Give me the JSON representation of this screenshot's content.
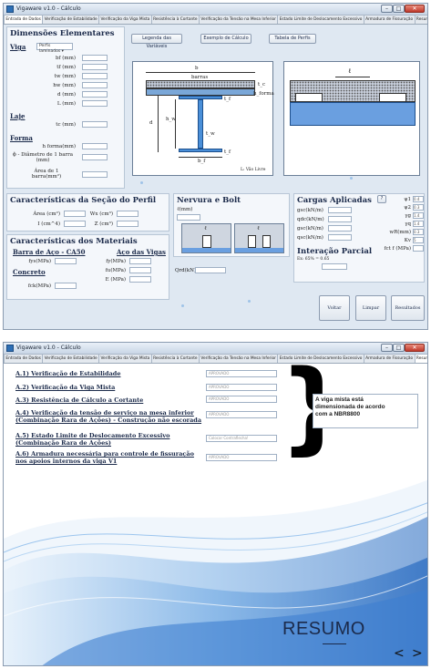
{
  "window": {
    "title": "Vigaware v1.0 - Cálculo",
    "minimize": "–",
    "maximize": "□",
    "close": "✕"
  },
  "tabs": [
    "Entrada de Dados",
    "Verificação de Estabilidade",
    "Verificação da Viga Mista",
    "Resistência à Cortante",
    "Verificação da Tensão na Mesa Inferior",
    "Estado Limite de Deslocamento Excessivo",
    "Armadura de Fissuração",
    "Resumo"
  ],
  "screen1": {
    "dim_title": "Dimensões Elementares",
    "viga_label": "Viga",
    "profile_select": "Perfis laminados",
    "viga_fields": [
      "bf (mm)",
      "tf (mm)",
      "tw (mm)",
      "hw (mm)",
      "d (mm)",
      "L (mm)"
    ],
    "laje_label": "Laje",
    "laje_fields": [
      "tc (mm)"
    ],
    "forma_label": "Forma",
    "forma_fields": [
      "h forma(mm)",
      "ϕ - Diâmetro de 1 barra (mm)",
      "Área de 1 barra(mm²)"
    ],
    "buttons": {
      "legenda": "Legenda das Variáveis",
      "exemplo": "Exemplo de Cálculo",
      "tabela": "Tabela de Perfis"
    },
    "drawing": {
      "b": "b",
      "barras": "barras",
      "tc": "t_c",
      "hforma": "h_forma",
      "tf_top": "t_f",
      "d": "d",
      "hw": "h_w",
      "tw": "t_w",
      "bf": "b_f",
      "tf_bottom": "t_f",
      "footer": "L: Vão Livre",
      "l_right": "ℓ"
    },
    "secao_title": "Características da Seção do Perfil",
    "secao_fields": {
      "area": "Área (cm²)",
      "wx": "Wx (cm³)",
      "i": "I (cm^4)",
      "z": "Z (cm³)"
    },
    "materiais_title": "Características dos Materiais",
    "barra_label": "Barra de Aço - CA50",
    "aco_label": "Aço das Vigas",
    "fys": "fys(MPa)",
    "fy": "fy(MPa)",
    "fu": "fu(MPa)",
    "e": "E (MPa)",
    "concreto_label": "Concreto",
    "fck": "fck(MPa)",
    "nervura_title": "Nervura e Bolt",
    "l_mm": "ℓ(mm)",
    "nervura_l": "ℓ",
    "qrd": "Qrd(kN)",
    "cargas_title": "Cargas Aplicadas",
    "cargas_fields": [
      "gsc(kN/m)",
      "qdc(kN/m)",
      "gsc(kN/m)",
      "qsc(kN/m)"
    ],
    "right_fields": [
      {
        "label": "ψ1",
        "value": "0.4"
      },
      {
        "label": "ψ2",
        "value": "0.3"
      },
      {
        "label": "γg",
        "value": "1.4"
      },
      {
        "label": "γq",
        "value": "1.4"
      },
      {
        "label": "wR(mm)",
        "value": "0.3"
      },
      {
        "label": "Kv",
        "value": "5"
      },
      {
        "label": "fct f (MPa)",
        "value": ""
      }
    ],
    "interacao_title": "Interação Parcial",
    "interacao_sub": "Ex: 65% = 0.65",
    "help_btn": "?",
    "voltar": "Voltar",
    "limpar": "Limpar",
    "resultados": "Resultados"
  },
  "screen2": {
    "items": [
      {
        "title": "A.1) Verificação de Estabilidade",
        "status": "APROVADO"
      },
      {
        "title": "A.2) Verificação da Viga Mista",
        "status": "APROVADO"
      },
      {
        "title": "A.3) Resistência de Cálculo a Cortante",
        "status": "APROVADO"
      },
      {
        "title": "A.4) Verificação da tensão de serviço na mesa inferior (Combinação Rara de Ações) - Construção não escorada",
        "status": "APROVADO"
      },
      {
        "title": "A.5) Estado Limite de Deslocamento Excessivo (Combinação Rara de Ações)",
        "status": "Colocar Contraflecha!"
      },
      {
        "title": "A.6) Armadura necessária para controle de fissuração nos apoios internos da viga V1",
        "status": "APROVADO"
      }
    ],
    "message": "A viga mista está dimensionada de acordo com a NBR8800",
    "resumo": "RESUMO",
    "prev": "<",
    "next": ">"
  }
}
